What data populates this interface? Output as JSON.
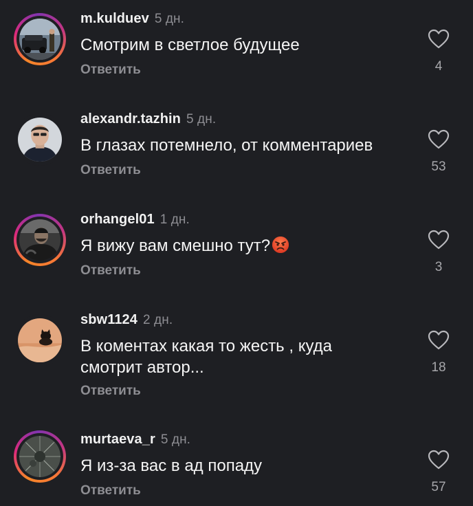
{
  "comments": [
    {
      "username": "m.kulduev",
      "time": "5 дн.",
      "text": "Смотрим в светлое будущее",
      "reply_label": "Ответить",
      "likes": "4",
      "heart_icon": "heart-outline-icon"
    },
    {
      "username": "alexandr.tazhin",
      "time": "5 дн.",
      "text": "В глазах потемнело, от комментариев",
      "reply_label": "Ответить",
      "likes": "53",
      "heart_icon": "heart-outline-icon"
    },
    {
      "username": "orhangel01",
      "time": "1 дн.",
      "text": "Я вижу вам смешно тут?",
      "emoji": "angry-face-emoji",
      "reply_label": "Ответить",
      "likes": "3",
      "heart_icon": "heart-outline-icon"
    },
    {
      "username": "sbw1124",
      "time": "2 дн.",
      "text": "В коментах какая то жесть , куда смотрит автор...",
      "reply_label": "Ответить",
      "likes": "18",
      "heart_icon": "heart-outline-icon"
    },
    {
      "username": "murtaeva_r",
      "time": "5 дн.",
      "text": "Я из-за вас в ад попаду",
      "reply_label": "Ответить",
      "likes": "57",
      "heart_icon": "heart-outline-icon"
    }
  ],
  "colors": {
    "background": "#1e1f23",
    "secondary_text": "#8e8e93",
    "primary_text": "#f5f5f5",
    "story_ring": "#dd2a7b"
  }
}
